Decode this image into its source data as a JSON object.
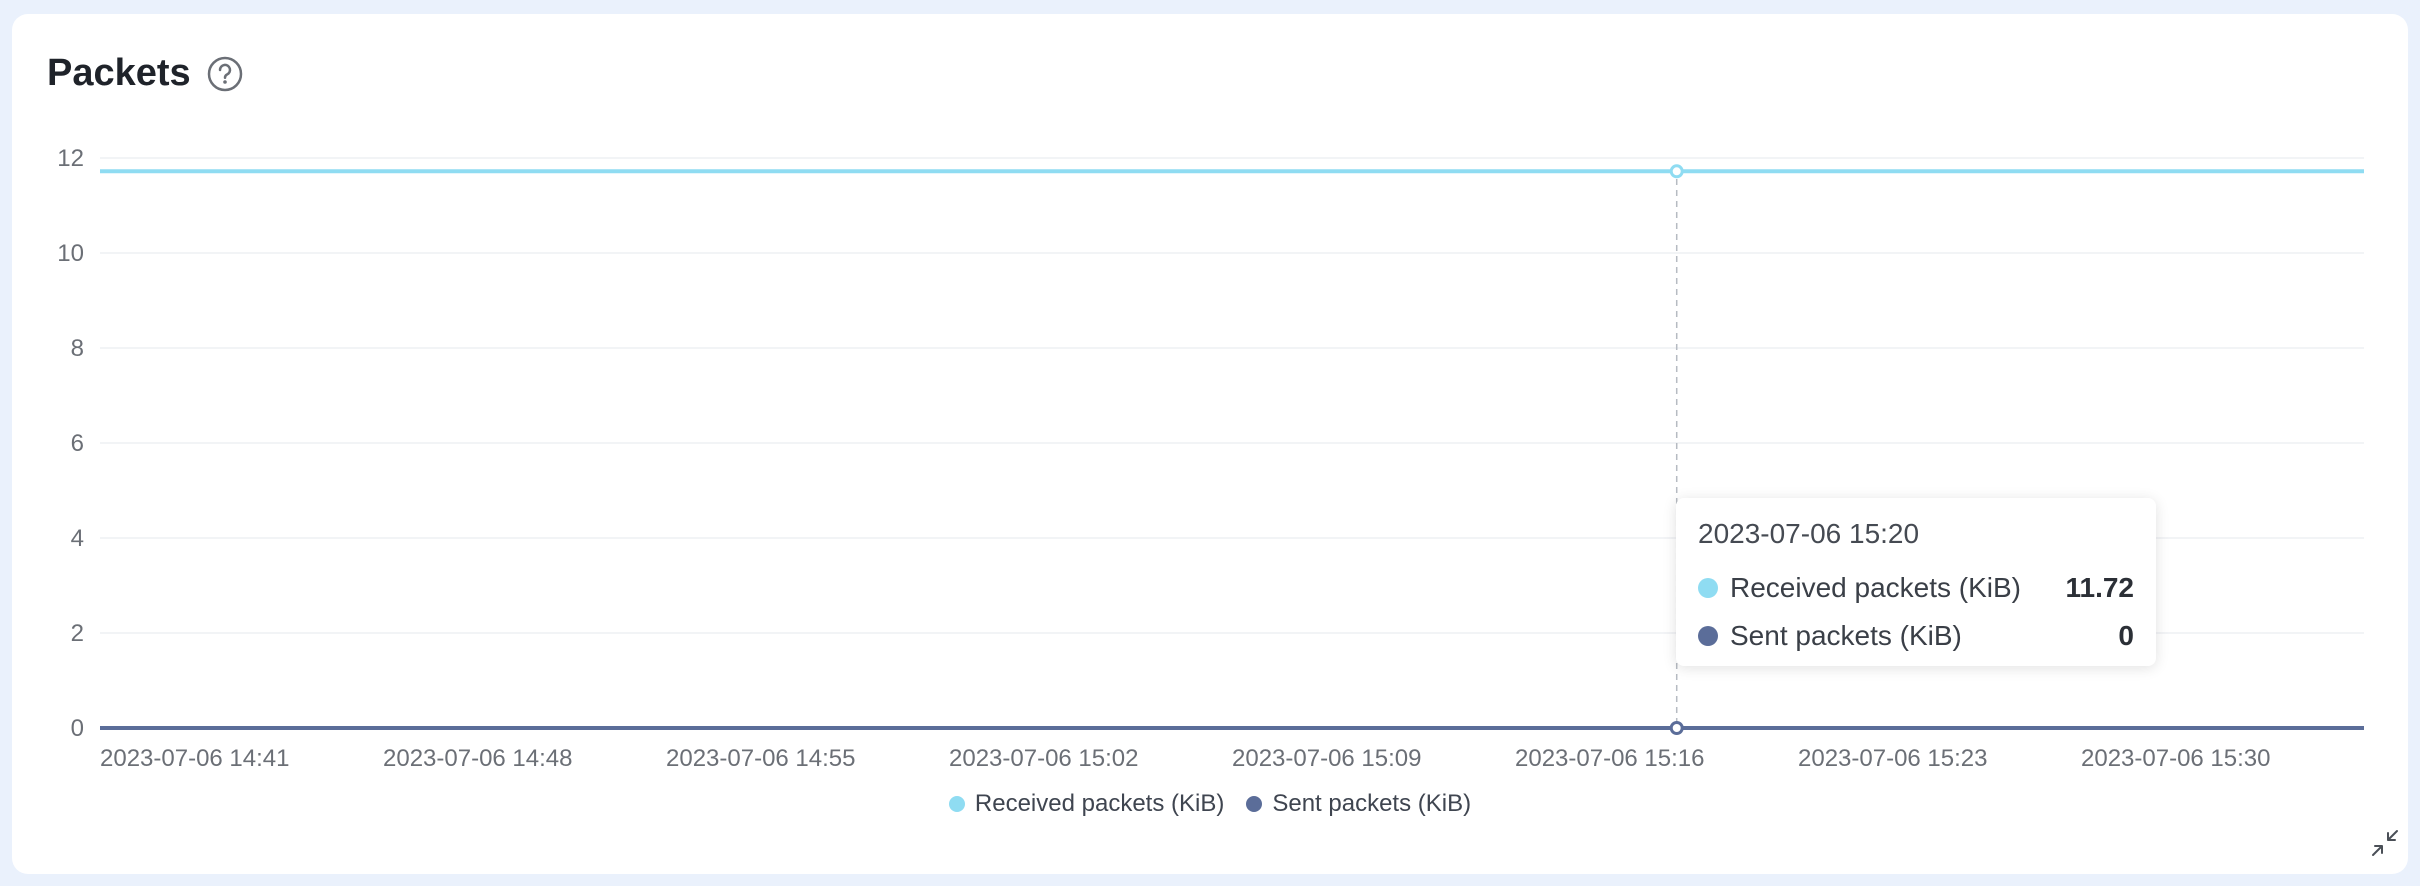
{
  "panel": {
    "title": "Packets",
    "help_icon": "question-circle-icon",
    "collapse_icon": "collapse-arrows-icon"
  },
  "colors": {
    "received": "#8fdcf2",
    "sent": "#5b6d99",
    "grid": "#eef0f3",
    "crosshair": "#b6bbc2"
  },
  "chart_data": {
    "type": "line",
    "title": "Packets",
    "xlabel": "",
    "ylabel": "",
    "ylim": [
      0,
      12
    ],
    "y_ticks": [
      0,
      2,
      4,
      6,
      8,
      10,
      12
    ],
    "x_ticks": [
      "2023-07-06 14:41",
      "2023-07-06 14:48",
      "2023-07-06 14:55",
      "2023-07-06 15:02",
      "2023-07-06 15:09",
      "2023-07-06 15:16",
      "2023-07-06 15:23",
      "2023-07-06 15:30"
    ],
    "x_range": [
      "2023-07-06 14:41",
      "2023-07-06 15:37"
    ],
    "grid": true,
    "legend_position": "bottom-center",
    "series": [
      {
        "name": "Received packets (KiB)",
        "color": "#8fdcf2",
        "constant_value": 11.72
      },
      {
        "name": "Sent packets (KiB)",
        "color": "#5b6d99",
        "constant_value": 0
      }
    ],
    "hover": {
      "time": "2023-07-06 15:20",
      "values": [
        {
          "name": "Received packets (KiB)",
          "value": "11.72"
        },
        {
          "name": "Sent packets (KiB)",
          "value": "0"
        }
      ]
    }
  }
}
